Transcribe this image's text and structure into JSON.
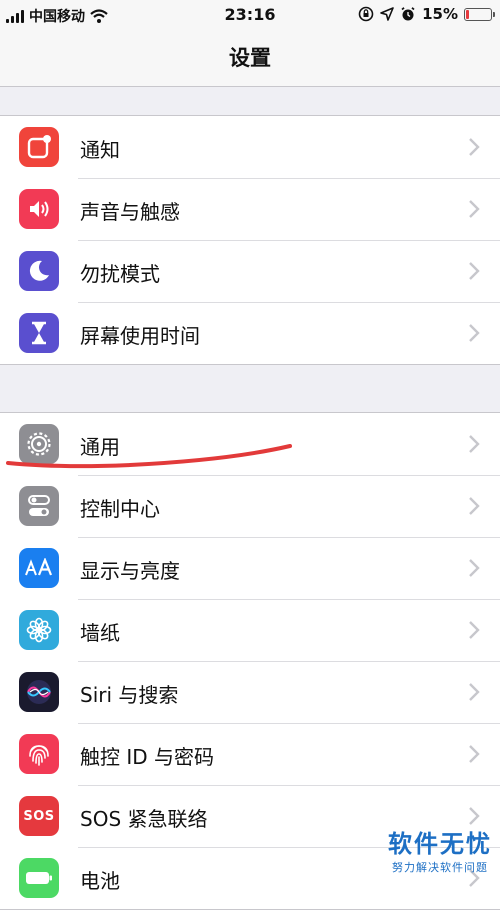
{
  "status_bar": {
    "carrier": "中国移动",
    "time": "23:16",
    "battery_percent": "15%",
    "battery_level": 0.15,
    "icons": [
      "signal-icon",
      "wifi-icon",
      "orientation-lock-icon",
      "location-icon",
      "alarm-icon",
      "battery-icon"
    ]
  },
  "nav": {
    "title": "设置"
  },
  "groups": [
    {
      "items": [
        {
          "label": "通知",
          "icon": "notification-icon",
          "color": "#f0443b"
        },
        {
          "label": "声音与触感",
          "icon": "sound-icon",
          "color": "#f23a55"
        },
        {
          "label": "勿扰模式",
          "icon": "moon-icon",
          "color": "#5a4fcf"
        },
        {
          "label": "屏幕使用时间",
          "icon": "hourglass-icon",
          "color": "#5a4fcf"
        }
      ]
    },
    {
      "items": [
        {
          "label": "通用",
          "icon": "gear-icon",
          "color": "#8e8e93"
        },
        {
          "label": "控制中心",
          "icon": "toggles-icon",
          "color": "#8e8e93"
        },
        {
          "label": "显示与亮度",
          "icon": "text-size-icon",
          "color": "#1a7ff0"
        },
        {
          "label": "墙纸",
          "icon": "flower-icon",
          "color": "#30aadc"
        },
        {
          "label": "Siri 与搜索",
          "icon": "siri-icon",
          "color": "#1a1a2e"
        },
        {
          "label": "触控 ID 与密码",
          "icon": "fingerprint-icon",
          "color": "#f23a55"
        },
        {
          "label": "SOS 紧急联络",
          "icon": "sos-icon",
          "color": "#e5393e",
          "icon_text": "SOS"
        },
        {
          "label": "电池",
          "icon": "battery-setting-icon",
          "color": "#4cd964"
        }
      ]
    }
  ],
  "watermark": {
    "title": "软件无忧",
    "subtitle": "努力解决软件问题"
  }
}
